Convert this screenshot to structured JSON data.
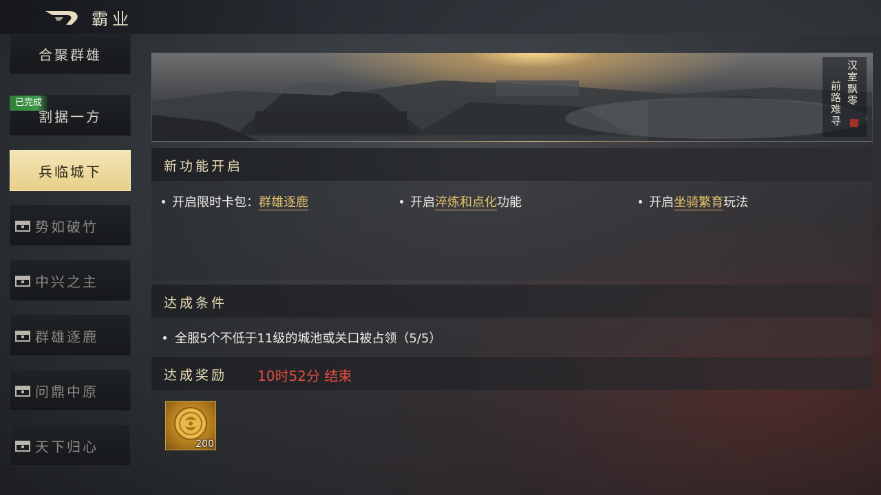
{
  "header": {
    "title": "霸业",
    "back_icon": "back-arrow-icon"
  },
  "sidebar": {
    "items": [
      {
        "label": "合聚群雄",
        "state": "partial-visible"
      },
      {
        "label": "割据一方",
        "state": "completed",
        "tag": "已完成"
      },
      {
        "label": "兵临城下",
        "state": "active"
      },
      {
        "label": "势如破竹",
        "state": "locked",
        "icon": "chest-icon"
      },
      {
        "label": "中兴之主",
        "state": "locked",
        "icon": "chest-icon"
      },
      {
        "label": "群雄逐鹿",
        "state": "locked",
        "icon": "chest-icon"
      },
      {
        "label": "问鼎中原",
        "state": "locked",
        "icon": "chest-icon"
      },
      {
        "label": "天下归心",
        "state": "locked",
        "icon": "chest-icon"
      }
    ]
  },
  "banner": {
    "line1": "汉室飘零",
    "line2": "前路难寻"
  },
  "new_features": {
    "title": "新功能开启",
    "items": [
      {
        "prefix": "开启限时卡包：",
        "highlight": "群雄逐鹿",
        "suffix": ""
      },
      {
        "prefix": "开启",
        "highlight": "淬炼和点化",
        "suffix": "功能"
      },
      {
        "prefix": "开启",
        "highlight": "坐骑繁育",
        "suffix": "玩法"
      }
    ]
  },
  "conditions": {
    "title": "达成条件",
    "items": [
      {
        "text": "全服5个不低于11级的城池或关口被占领（5/5）"
      }
    ]
  },
  "rewards": {
    "title": "达成奖励",
    "timer": "10时52分 结束",
    "items": [
      {
        "icon": "gold-coin-icon",
        "count": "200"
      }
    ]
  },
  "colors": {
    "highlight": "#e8c46e",
    "timer": "#e54d42",
    "completed_tag": "#3f9b48",
    "active_stage": "#f0dfa6"
  }
}
